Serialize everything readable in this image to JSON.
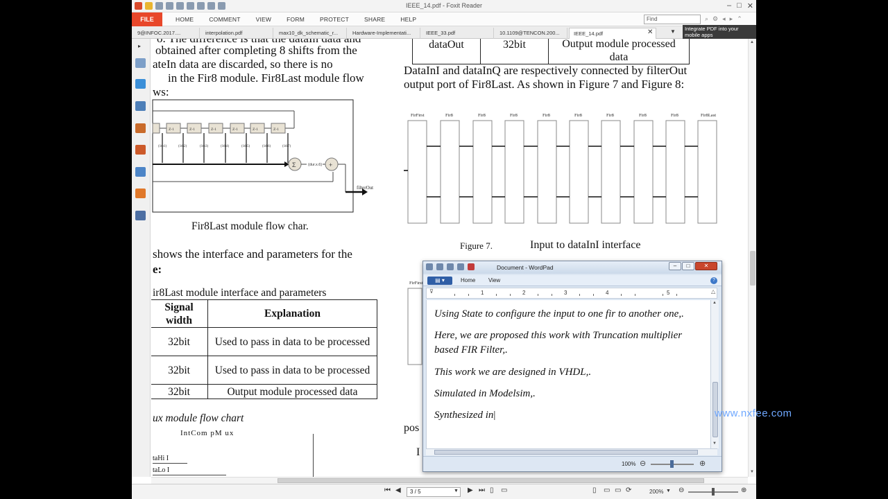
{
  "window": {
    "title": "IEEE_14.pdf - Foxit Reader"
  },
  "menu": {
    "file": "FILE",
    "items": [
      "HOME",
      "COMMENT",
      "VIEW",
      "FORM",
      "PROTECT",
      "SHARE",
      "HELP"
    ],
    "find_placeholder": "Find"
  },
  "tabs": [
    {
      "label": "9@INFOC.2017...."
    },
    {
      "label": "interpolation.pdf"
    },
    {
      "label": "max10_dk_schematic_r..."
    },
    {
      "label": "Hardware-Implementati..."
    },
    {
      "label": "IEEE_33.pdf"
    },
    {
      "label": "10.1109@TENCON.200..."
    },
    {
      "label": "IEEE_14.pdf"
    }
  ],
  "ad": {
    "text": "Integrate PDF into your mobile apps"
  },
  "pdf": {
    "left_lines": [
      "o. The difference is that the dataIn data and",
      "obtained after completing 8 shifts from the",
      "ateIn data are discarded, so there is no",
      "in the Fir8 module. Fir8Last module flow",
      "ws:"
    ],
    "fig_left_caption": "Fir8Last module flow char.",
    "para2": [
      "shows the interface and parameters for the",
      "e:"
    ],
    "table_caption": "ir8Last module interface and parameters",
    "table": {
      "headers": [
        "Signal width",
        "Explanation"
      ],
      "rows": [
        [
          "32bit",
          "Used to pass in data to be processed"
        ],
        [
          "32bit",
          "Used to pass in data to be processed"
        ],
        [
          "32bit",
          "Output module processed data"
        ]
      ]
    },
    "mux_caption": "ux module flow chart",
    "mux_title": "IntCom pM ux",
    "mux_labels": [
      "taHi I",
      "taLo I"
    ],
    "right_table": {
      "cells": [
        "dataOut",
        "32bit",
        "Output module processed data"
      ]
    },
    "right_lines": [
      "DataInI and dataInQ are respectively connected by filterOut",
      "output port of Fir8Last. As shown in Figure 7 and Figure 8:"
    ],
    "fig7_label": "Figure 7.",
    "fig7_caption": "Input to dataInI interface",
    "block_labels": [
      "FirFirst",
      "Fir8",
      "Fir8",
      "Fir8",
      "Fir8",
      "Fir8",
      "Fir8",
      "Fir8",
      "Fir8",
      "Fir8Last"
    ],
    "fragment_right": [
      "pos",
      "I"
    ],
    "diagram_sum_label": "(dur.x.6)",
    "diagram_out_label": "filterOut",
    "z_label": "Z-1",
    "tap_labels": [
      "(1tb1)",
      "(1tb2)",
      "(1tb3)",
      "(1tb4)",
      "(1tb5)",
      "(1tb6)",
      "(1tb7)"
    ]
  },
  "status": {
    "page": "3 / 5",
    "zoom": "200%"
  },
  "wordpad": {
    "title": "Document - WordPad",
    "tabs": [
      "Home",
      "View"
    ],
    "ruler_numbers": [
      "1",
      "2",
      "3",
      "4",
      "5"
    ],
    "paragraphs": [
      "Using State to configure the input to one fir to another one,.",
      "Here, we are proposed this work with Truncation multiplier",
      "based FIR Filter,.",
      "This work we are designed in VHDL,.",
      "Simulated in Modelsim,.",
      "Synthesized in"
    ],
    "zoom": "100%"
  },
  "watermark": "www.nxfee.com"
}
